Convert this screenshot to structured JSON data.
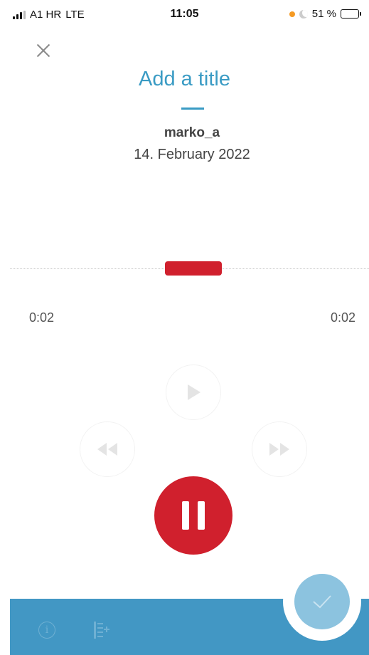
{
  "status_bar": {
    "carrier": "A1 HR",
    "network": "LTE",
    "time": "11:05",
    "battery_text": "51 %",
    "battery_level": 0.51
  },
  "recording": {
    "title_placeholder": "Add a title",
    "user": "marko_a",
    "date": "14. February 2022",
    "time_elapsed": "0:02",
    "time_total": "0:02"
  },
  "colors": {
    "accent_blue": "#3a9bc4",
    "record_red": "#d0202d",
    "bottom_bar": "#4297c4",
    "confirm_disabled": "#8cc3df"
  },
  "icons": {
    "close": "close-icon",
    "play": "play-icon",
    "rewind": "rewind-icon",
    "fast_forward": "fast-forward-icon",
    "pause": "pause-icon",
    "info": "info-icon",
    "marker": "marker-icon",
    "confirm": "checkmark-icon"
  }
}
